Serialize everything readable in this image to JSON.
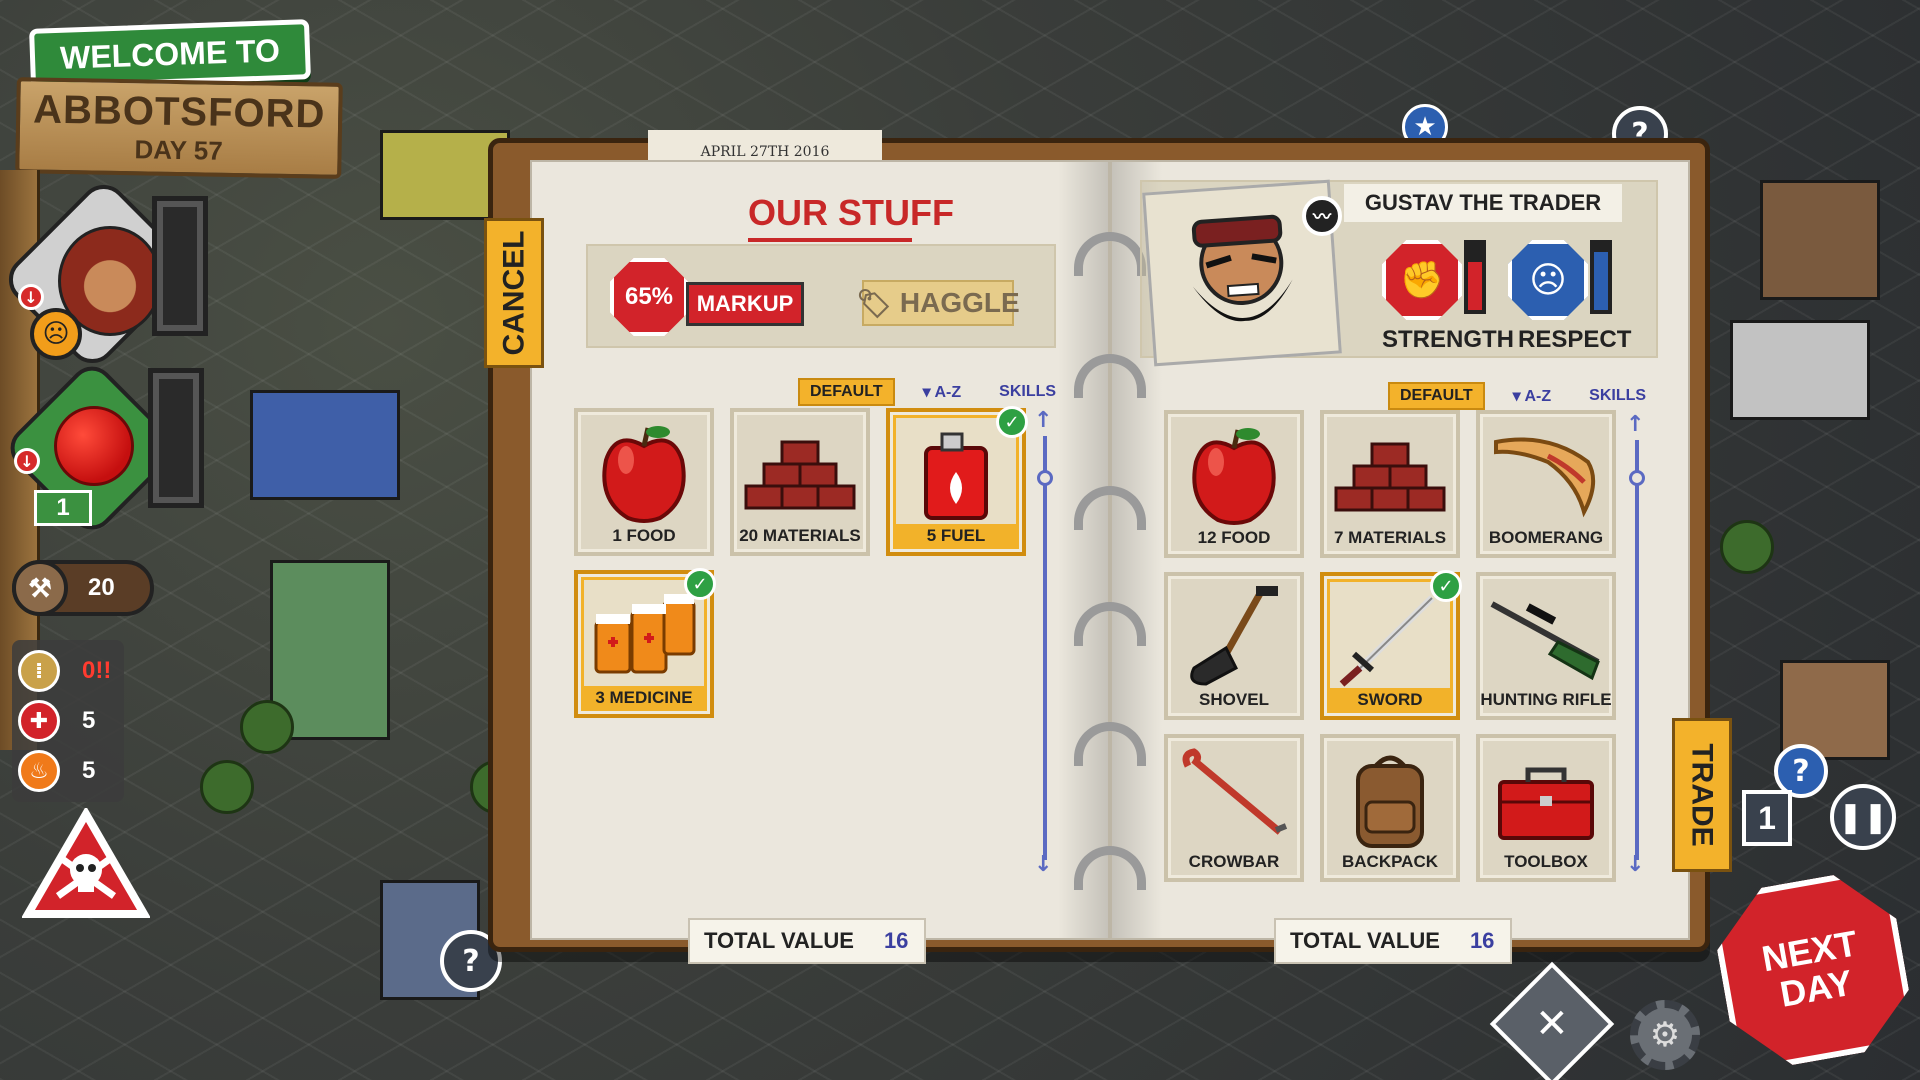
{
  "hud": {
    "welcome": "WELCOME TO",
    "town": "ABBOTSFORD",
    "day": "DAY 57",
    "food_count": "1",
    "materials_count": "20",
    "ammo_value": "0!!",
    "medicine_value": "5",
    "fuel_value": "5"
  },
  "journal": {
    "date": "APRIL 27TH 2016",
    "cancel_tab": "CANCEL",
    "trade_tab": "TRADE",
    "left": {
      "heading": "OUR STUFF",
      "markup_pct": "65%",
      "markup_label": "MARKUP",
      "haggle_label": "HAGGLE",
      "sort": {
        "default": "DEFAULT",
        "az": "▾ A-Z",
        "skills": "SKILLS"
      },
      "items": [
        {
          "label": "1 FOOD",
          "icon": "apple-icon",
          "selected": false
        },
        {
          "label": "20 MATERIALS",
          "icon": "bricks-icon",
          "selected": false
        },
        {
          "label": "5 FUEL",
          "icon": "fuel-can-icon",
          "selected": true
        },
        {
          "label": "3 MEDICINE",
          "icon": "medicine-bottles-icon",
          "selected": true
        }
      ],
      "total_label": "TOTAL VALUE",
      "total_value": "16"
    },
    "right": {
      "trader_name": "GUSTAV THE TRADER",
      "strength_label": "STRENGTH",
      "respect_label": "RESPECT",
      "strength_level": 0.7,
      "respect_level": 0.85,
      "sort": {
        "default": "DEFAULT",
        "az": "▾ A-Z",
        "skills": "SKILLS"
      },
      "items": [
        {
          "label": "12 FOOD",
          "icon": "apple-icon",
          "selected": false
        },
        {
          "label": "7 MATERIALS",
          "icon": "bricks-icon",
          "selected": false
        },
        {
          "label": "BOOMERANG",
          "icon": "boomerang-icon",
          "selected": false
        },
        {
          "label": "SHOVEL",
          "icon": "shovel-icon",
          "selected": false
        },
        {
          "label": "SWORD",
          "icon": "sword-icon",
          "selected": true
        },
        {
          "label": "HUNTING RIFLE",
          "icon": "rifle-icon",
          "selected": false
        },
        {
          "label": "CROWBAR",
          "icon": "crowbar-icon",
          "selected": false
        },
        {
          "label": "BACKPACK",
          "icon": "backpack-icon",
          "selected": false
        },
        {
          "label": "TOOLBOX",
          "icon": "toolbox-icon",
          "selected": false
        }
      ],
      "total_label": "TOTAL VALUE",
      "total_value": "16"
    }
  },
  "controls": {
    "next_day": "NEXT DAY",
    "game_speed": "1",
    "pause_icon": "pause-icon",
    "help_icon": "question-icon",
    "settings_icon": "gear-icon"
  },
  "colors": {
    "accent_yellow": "#f3b22b",
    "danger_red": "#d2232a",
    "check_green": "#2ea043",
    "ink_blue": "#3b3fa0"
  }
}
